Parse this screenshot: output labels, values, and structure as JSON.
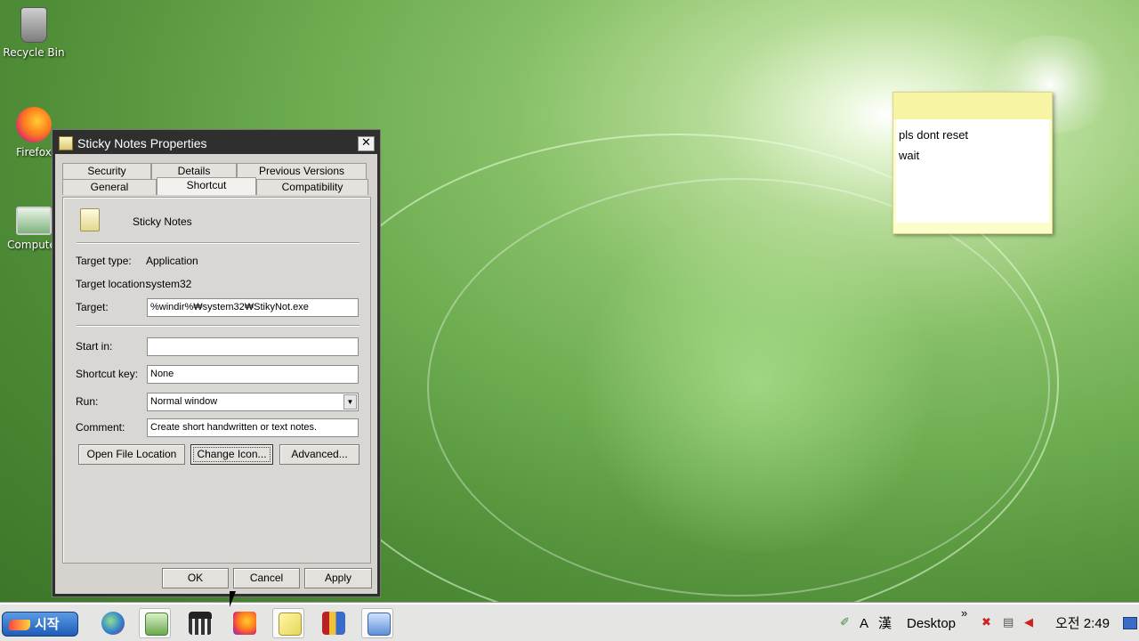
{
  "desktop": {
    "icons": [
      {
        "label": "Recycle Bin",
        "icon": "recycle-bin-icon"
      },
      {
        "label": "Firefox",
        "icon": "firefox-icon"
      },
      {
        "label": "Computer",
        "icon": "computer-icon"
      }
    ]
  },
  "sticky_note": {
    "lines": [
      "pls dont reset",
      "wait"
    ]
  },
  "dialog": {
    "title": "Sticky Notes Properties",
    "close_glyph": "✕",
    "tabs_row1": [
      "Security",
      "Details",
      "Previous Versions"
    ],
    "tabs_row2": [
      "General",
      "Shortcut",
      "Compatibility"
    ],
    "active_tab": "Shortcut",
    "app_name": "Sticky Notes",
    "target_type_label": "Target type:",
    "target_type_value": "Application",
    "target_location_label": "Target location:",
    "target_location_value": "system32",
    "target_label": "Target:",
    "target_value": "%windir%₩system32₩StikyNot.exe",
    "start_in_label": "Start in:",
    "start_in_value": "",
    "shortcut_key_label": "Shortcut key:",
    "shortcut_key_value": "None",
    "run_label": "Run:",
    "run_value": "Normal window",
    "comment_label": "Comment:",
    "comment_value": "Create short handwritten or text notes.",
    "open_file_location_label": "Open File Location",
    "change_icon_label": "Change Icon...",
    "advanced_label": "Advanced...",
    "ok_label": "OK",
    "cancel_label": "Cancel",
    "apply_label": "Apply"
  },
  "taskbar": {
    "start_label": "시작",
    "desktop_label": "Desktop",
    "more_glyph": "»",
    "ime_a": "A",
    "ime_han": "漢",
    "clock": "오전 2:49"
  },
  "colors": {
    "accent": "#2f2f2f",
    "start_button": "#1e5cb8",
    "sticky_yellow": "#f7f4a3"
  }
}
